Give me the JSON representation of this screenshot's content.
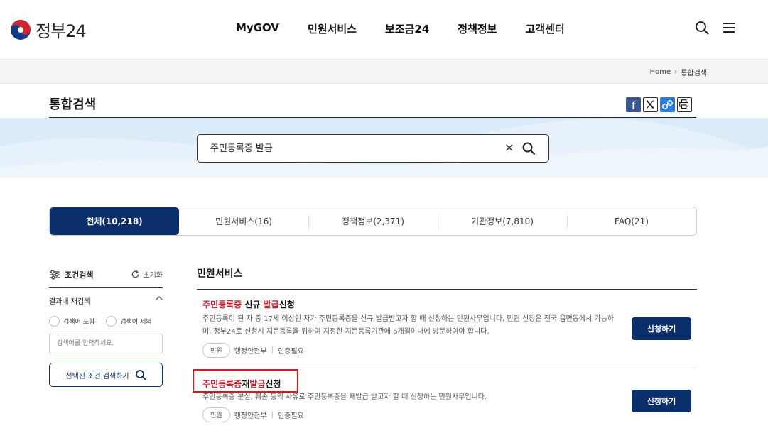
{
  "header": {
    "logo_text": "정부24",
    "nav": [
      "MyGOV",
      "민원서비스",
      "보조금24",
      "정책정보",
      "고객센터"
    ]
  },
  "breadcrumb": {
    "home": "Home",
    "current": "통합검색"
  },
  "page": {
    "title": "통합검색"
  },
  "search": {
    "value": "주민등록증 발급",
    "clear": "×"
  },
  "tabs": [
    {
      "label": "전체(10,218)",
      "active": true
    },
    {
      "label": "민원서비스(16)",
      "active": false
    },
    {
      "label": "정책정보(2,371)",
      "active": false
    },
    {
      "label": "기관정보(7,810)",
      "active": false
    },
    {
      "label": "FAQ(21)",
      "active": false
    }
  ],
  "filter": {
    "title": "조건검색",
    "reset": "초기화",
    "refine_label": "결과내 재검색",
    "include_label": "검색어 포함",
    "exclude_label": "검색어 제외",
    "input_placeholder": "검색어를 입력하세요.",
    "submit_label": "선택된 조건 검색하기"
  },
  "results": {
    "section_title": "민원서비스",
    "items": [
      {
        "title_parts": [
          "주민등록증",
          " 신규 ",
          "발급",
          "신청"
        ],
        "description": "주민등록이 된 자 중 17세 이상인 자가 주민등록증을 신규 발급받고자 할 때 신청하는 민원사무입니다. 민원 신청은 전국 읍면동에서 가능하며, 정부24로 신청시 지문등록을 위하여 지정한 지문등록기관에 6개월이내에 방문하여야 합니다.",
        "badge": "민원",
        "agency": "행정안전부",
        "auth": "인증필요",
        "button": "신청하기"
      },
      {
        "title_parts": [
          "주민등록증",
          "재",
          "발급",
          "신청"
        ],
        "description": "주민등록증 분실, 훼손 등의 사유로 주민등록증을 재발급 받고자 할 때 신청하는 민원사무입니다.",
        "badge": "민원",
        "agency": "행정안전부",
        "auth": "인증필요",
        "button": "신청하기"
      }
    ]
  },
  "colors": {
    "primary": "#0b2f6b",
    "highlight": "#d2222d",
    "band": "#dcebf8"
  }
}
